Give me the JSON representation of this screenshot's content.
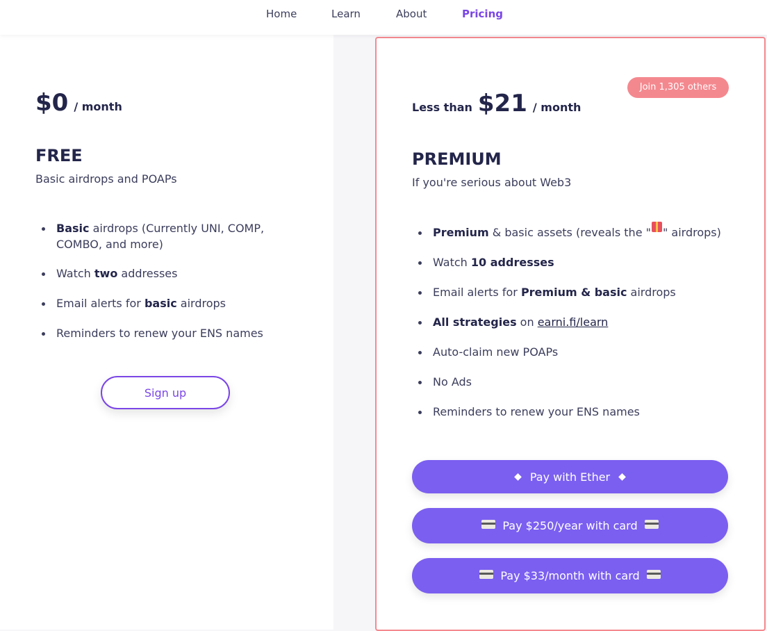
{
  "nav": {
    "home": "Home",
    "learn": "Learn",
    "about": "About",
    "pricing": "Pricing"
  },
  "free": {
    "price": "$0",
    "unit": "/ month",
    "title": "FREE",
    "subtitle": "Basic airdrops and POAPs",
    "features": [
      {
        "bold": "Basic",
        "text": " airdrops (Currently UNI, COMP, COMBO, and more)"
      },
      {
        "pre": "Watch ",
        "bold": "two",
        "post": " addresses"
      },
      {
        "pre": "Email alerts for ",
        "bold": "basic",
        "post": " airdrops"
      },
      {
        "text": "Reminders to renew your ENS names"
      }
    ],
    "signup": "Sign up"
  },
  "premium": {
    "badge": "Join 1,305 others",
    "price_prefix": "Less than",
    "price": "$21",
    "unit": "/ month",
    "title": "PREMIUM",
    "subtitle": "If you're serious about Web3",
    "features": [
      {
        "bold": "Premium",
        "pre": " & basic assets (reveals the \"",
        "post": "\" airdrops)",
        "icon": "gift-icon"
      },
      {
        "pre": "Watch ",
        "bold": "10 addresses"
      },
      {
        "pre": "Email alerts for ",
        "bold": "Premium & basic",
        "post": " airdrops"
      },
      {
        "bold": "All strategies",
        "pre": " on ",
        "link": "earni.fi/learn"
      },
      {
        "text": "Auto-claim new POAPs"
      },
      {
        "text": "No Ads"
      },
      {
        "text": "Reminders to renew your ENS names"
      }
    ],
    "buttons": {
      "ether": "Pay with Ether",
      "year": "Pay $250/year with card",
      "month": "Pay $33/month with card"
    }
  },
  "colors": {
    "accent": "#7a45e6",
    "button": "#7b5ff0",
    "premium_border": "#f4888f",
    "text_dark": "#23254a"
  }
}
